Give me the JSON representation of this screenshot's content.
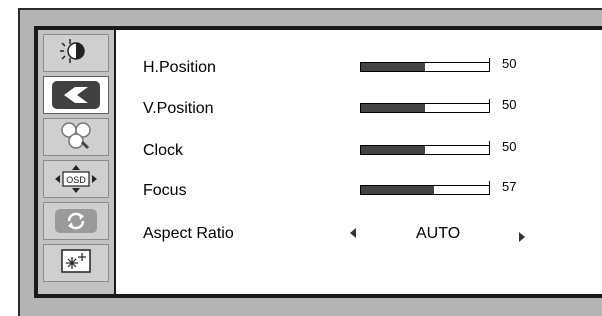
{
  "sidebar": {
    "tabs": [
      {
        "name": "brightness-contrast-tab",
        "icon": "brightness-contrast-icon",
        "active": false
      },
      {
        "name": "image-setup-tab",
        "icon": "image-setup-icon",
        "active": true
      },
      {
        "name": "color-temperature-tab",
        "icon": "color-temperature-icon",
        "active": false
      },
      {
        "name": "osd-setup-tab",
        "icon": "osd-icon",
        "label": "OSD",
        "active": false
      },
      {
        "name": "reset-tab",
        "icon": "reset-icon",
        "active": false
      },
      {
        "name": "misc-tab",
        "icon": "misc-settings-icon",
        "active": false
      }
    ]
  },
  "settings": [
    {
      "label": "H.Position",
      "value": "50",
      "level": 0.5
    },
    {
      "label": "V.Position",
      "value": "50",
      "level": 0.5
    },
    {
      "label": "Clock",
      "value": "50",
      "level": 0.5
    },
    {
      "label": "Focus",
      "value": "57",
      "level": 0.57
    }
  ],
  "aspect": {
    "label": "Aspect Ratio",
    "value": "AUTO"
  },
  "colors": {
    "bar_fill": "#444444",
    "frame": "#b4b4b4",
    "active_tab": "#ffffff"
  }
}
